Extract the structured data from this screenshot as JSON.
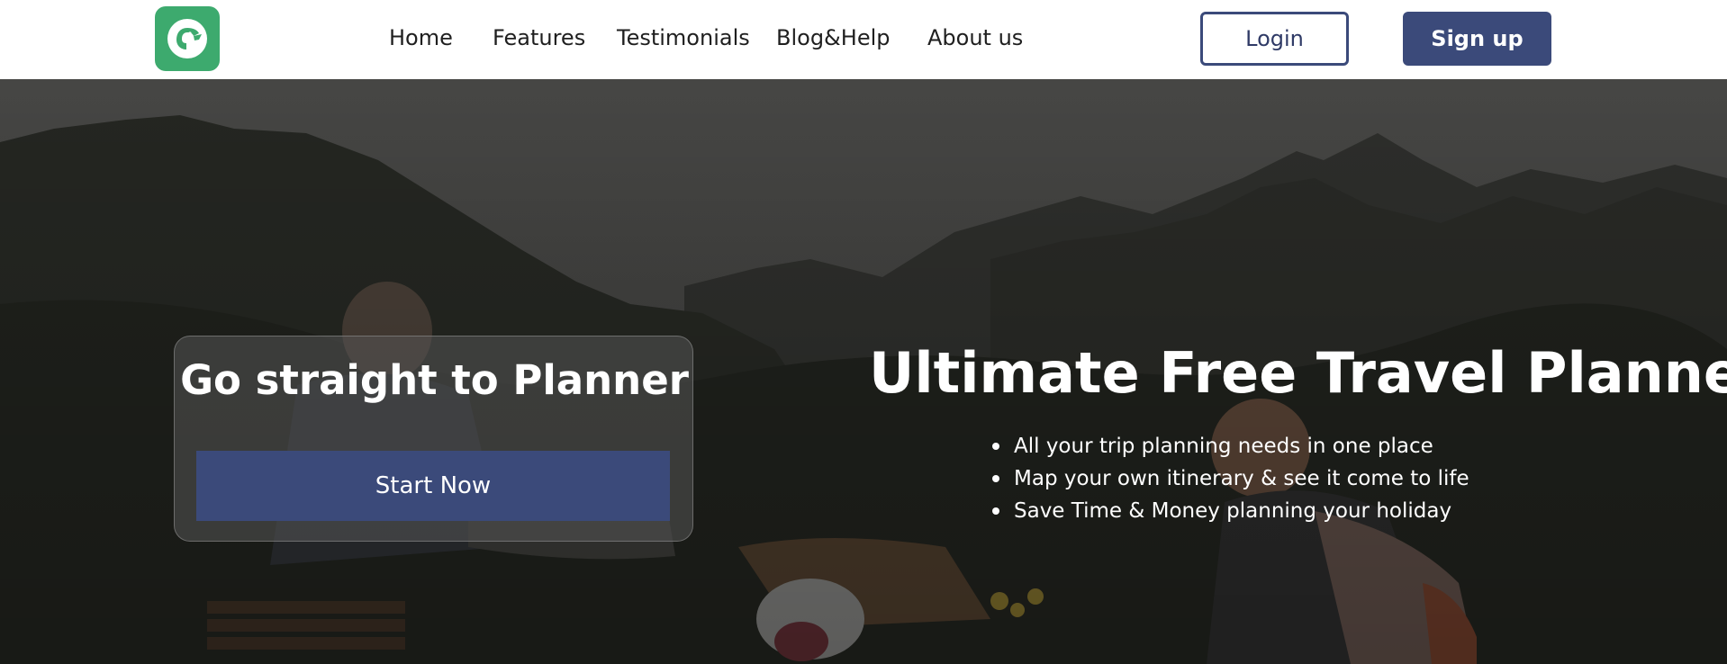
{
  "header": {
    "logo_icon": "green-bird-logo-icon",
    "nav": {
      "home": "Home",
      "features": "Features",
      "testimonials": "Testimonials",
      "blog": "Blog&Help",
      "about": "About us"
    },
    "login_label": "Login",
    "signup_label": "Sign up"
  },
  "hero": {
    "card": {
      "title": "Go straight to Planner",
      "button_label": "Start Now"
    },
    "headline": "Ultimate Free Travel Planner!",
    "bullets": [
      "All your trip planning needs in one place",
      "Map your own itinerary & see it come to life",
      "Save Time & Money planning your holiday"
    ]
  },
  "colors": {
    "brand_green": "#3daa6e",
    "primary_navy": "#3b4a7a",
    "white": "#ffffff"
  }
}
